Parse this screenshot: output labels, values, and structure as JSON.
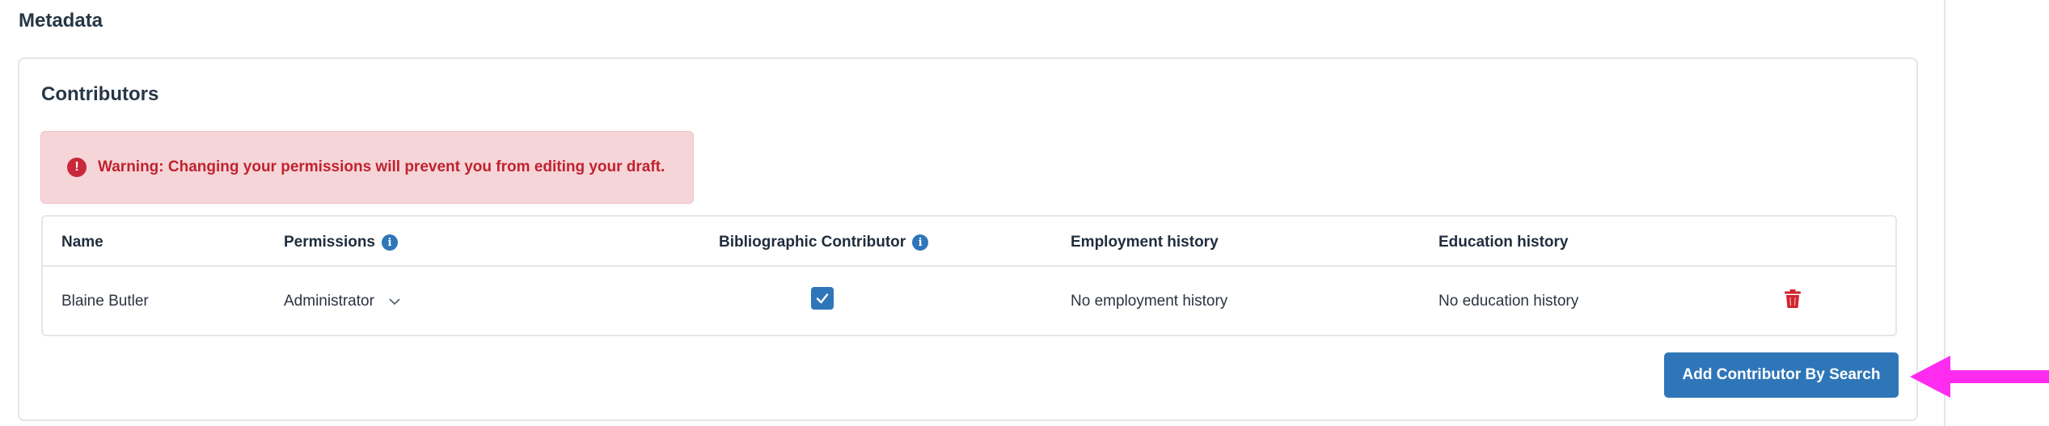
{
  "page": {
    "section_title": "Metadata"
  },
  "contributors": {
    "title": "Contributors",
    "warning": "Warning: Changing your permissions will prevent you from editing your draft.",
    "columns": {
      "name": "Name",
      "permissions": "Permissions",
      "bibliographic": "Bibliographic Contributor",
      "employment": "Employment history",
      "education": "Education history"
    },
    "rows": [
      {
        "name": "Blaine Butler",
        "permission": "Administrator",
        "bibliographic": true,
        "employment": "No employment history",
        "education": "No education history"
      }
    ],
    "add_button": "Add Contributor By Search"
  },
  "colors": {
    "primary": "#2f76b9",
    "danger": "#c0222f",
    "warning_bg": "#f5d5d8",
    "annotation_arrow": "#ff2cf0"
  },
  "icons": [
    "warning-icon",
    "info-icon",
    "chevron-down-icon",
    "check-icon",
    "trash-icon",
    "arrow-left-icon"
  ]
}
